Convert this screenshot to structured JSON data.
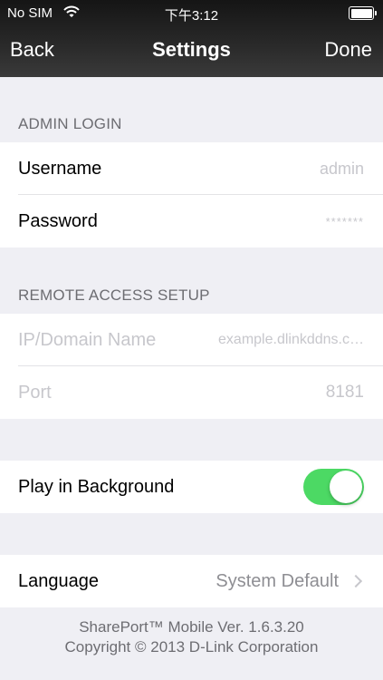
{
  "status_bar": {
    "carrier": "No SIM",
    "time": "下午3:12"
  },
  "nav": {
    "back_label": "Back",
    "title": "Settings",
    "done_label": "Done"
  },
  "admin_login": {
    "header": "ADMIN LOGIN",
    "username_label": "Username",
    "username_value": "admin",
    "password_label": "Password",
    "password_value": "*******"
  },
  "remote_access": {
    "header": "REMOTE ACCESS SETUP",
    "ip_label": "IP/Domain Name",
    "ip_value": "example.dlinkddns.c…",
    "port_label": "Port",
    "port_value": "8181"
  },
  "background": {
    "label": "Play in Background",
    "enabled": true,
    "toggle_color": "#4cd964"
  },
  "language": {
    "label": "Language",
    "value": "System Default"
  },
  "footer": {
    "version": "SharePort™ Mobile Ver. 1.6.3.20",
    "copyright": "Copyright © 2013 D-Link Corporation"
  }
}
